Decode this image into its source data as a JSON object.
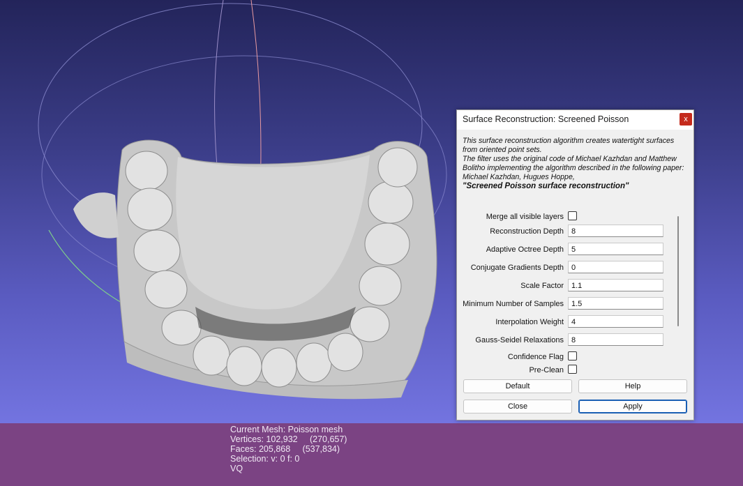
{
  "dialog": {
    "title": "Surface Reconstruction: Screened Poisson",
    "close_glyph": "x",
    "description": {
      "line1": "This surface reconstruction algorithm creates watertight surfaces",
      "line2": "from oriented point sets.",
      "line3": "The filter uses the original code of Michael Kazhdan and Matthew",
      "line4": "Bolitho implementing the algorithm described in the following paper:",
      "line5": "Michael Kazhdan, Hugues Hoppe,",
      "line6": "\"Screened Poisson surface reconstruction\""
    },
    "params": {
      "merge_layers": {
        "label": "Merge all visible layers",
        "checked": false
      },
      "reconstruction_depth": {
        "label": "Reconstruction Depth",
        "value": "8"
      },
      "adaptive_octree_depth": {
        "label": "Adaptive Octree Depth",
        "value": "5"
      },
      "conjugate_gradients_depth": {
        "label": "Conjugate Gradients Depth",
        "value": "0"
      },
      "scale_factor": {
        "label": "Scale Factor",
        "value": "1.1"
      },
      "min_samples": {
        "label": "Minimum Number of Samples",
        "value": "1.5"
      },
      "interpolation_weight": {
        "label": "Interpolation Weight",
        "value": "4"
      },
      "gauss_seidel": {
        "label": "Gauss-Seidel Relaxations",
        "value": "8"
      },
      "confidence_flag": {
        "label": "Confidence Flag",
        "checked": false
      },
      "pre_clean": {
        "label": "Pre-Clean",
        "checked": false
      }
    },
    "buttons": {
      "default": "Default",
      "help": "Help",
      "close": "Close",
      "apply": "Apply"
    }
  },
  "status": {
    "current_mesh": "Current Mesh: Poisson mesh",
    "vertices": "Vertices: 102,932     (270,657)",
    "faces": "Faces: 205,868     (537,834)",
    "selection": "Selection: v: 0 f: 0",
    "mode": "VQ"
  },
  "colors": {
    "status_bar": "#7b4383",
    "viewport_bottom": "#7374e0",
    "viewport_top": "#23245a",
    "apply_focus": "#1a5fb4"
  }
}
